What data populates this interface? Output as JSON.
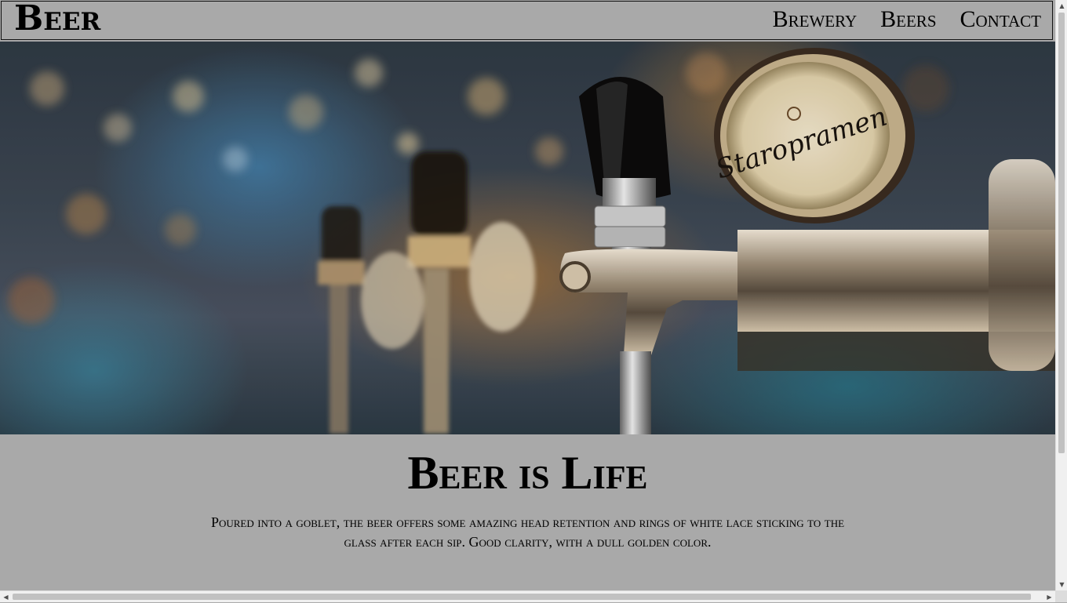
{
  "navbar": {
    "brand": "Beer",
    "links": [
      "Brewery",
      "Beers",
      "Contact"
    ]
  },
  "hero": {
    "image": "beer-taps-photo",
    "tap_label": "Staropramen"
  },
  "content": {
    "headline": "Beer is Life",
    "description": "Poured into a goblet, the beer offers some amazing head retention and rings of white lace sticking to the glass after each sip. Good clarity, with a dull golden color."
  },
  "scrollbars": {
    "up": "▲",
    "down": "▼",
    "left": "◀",
    "right": "▶"
  }
}
